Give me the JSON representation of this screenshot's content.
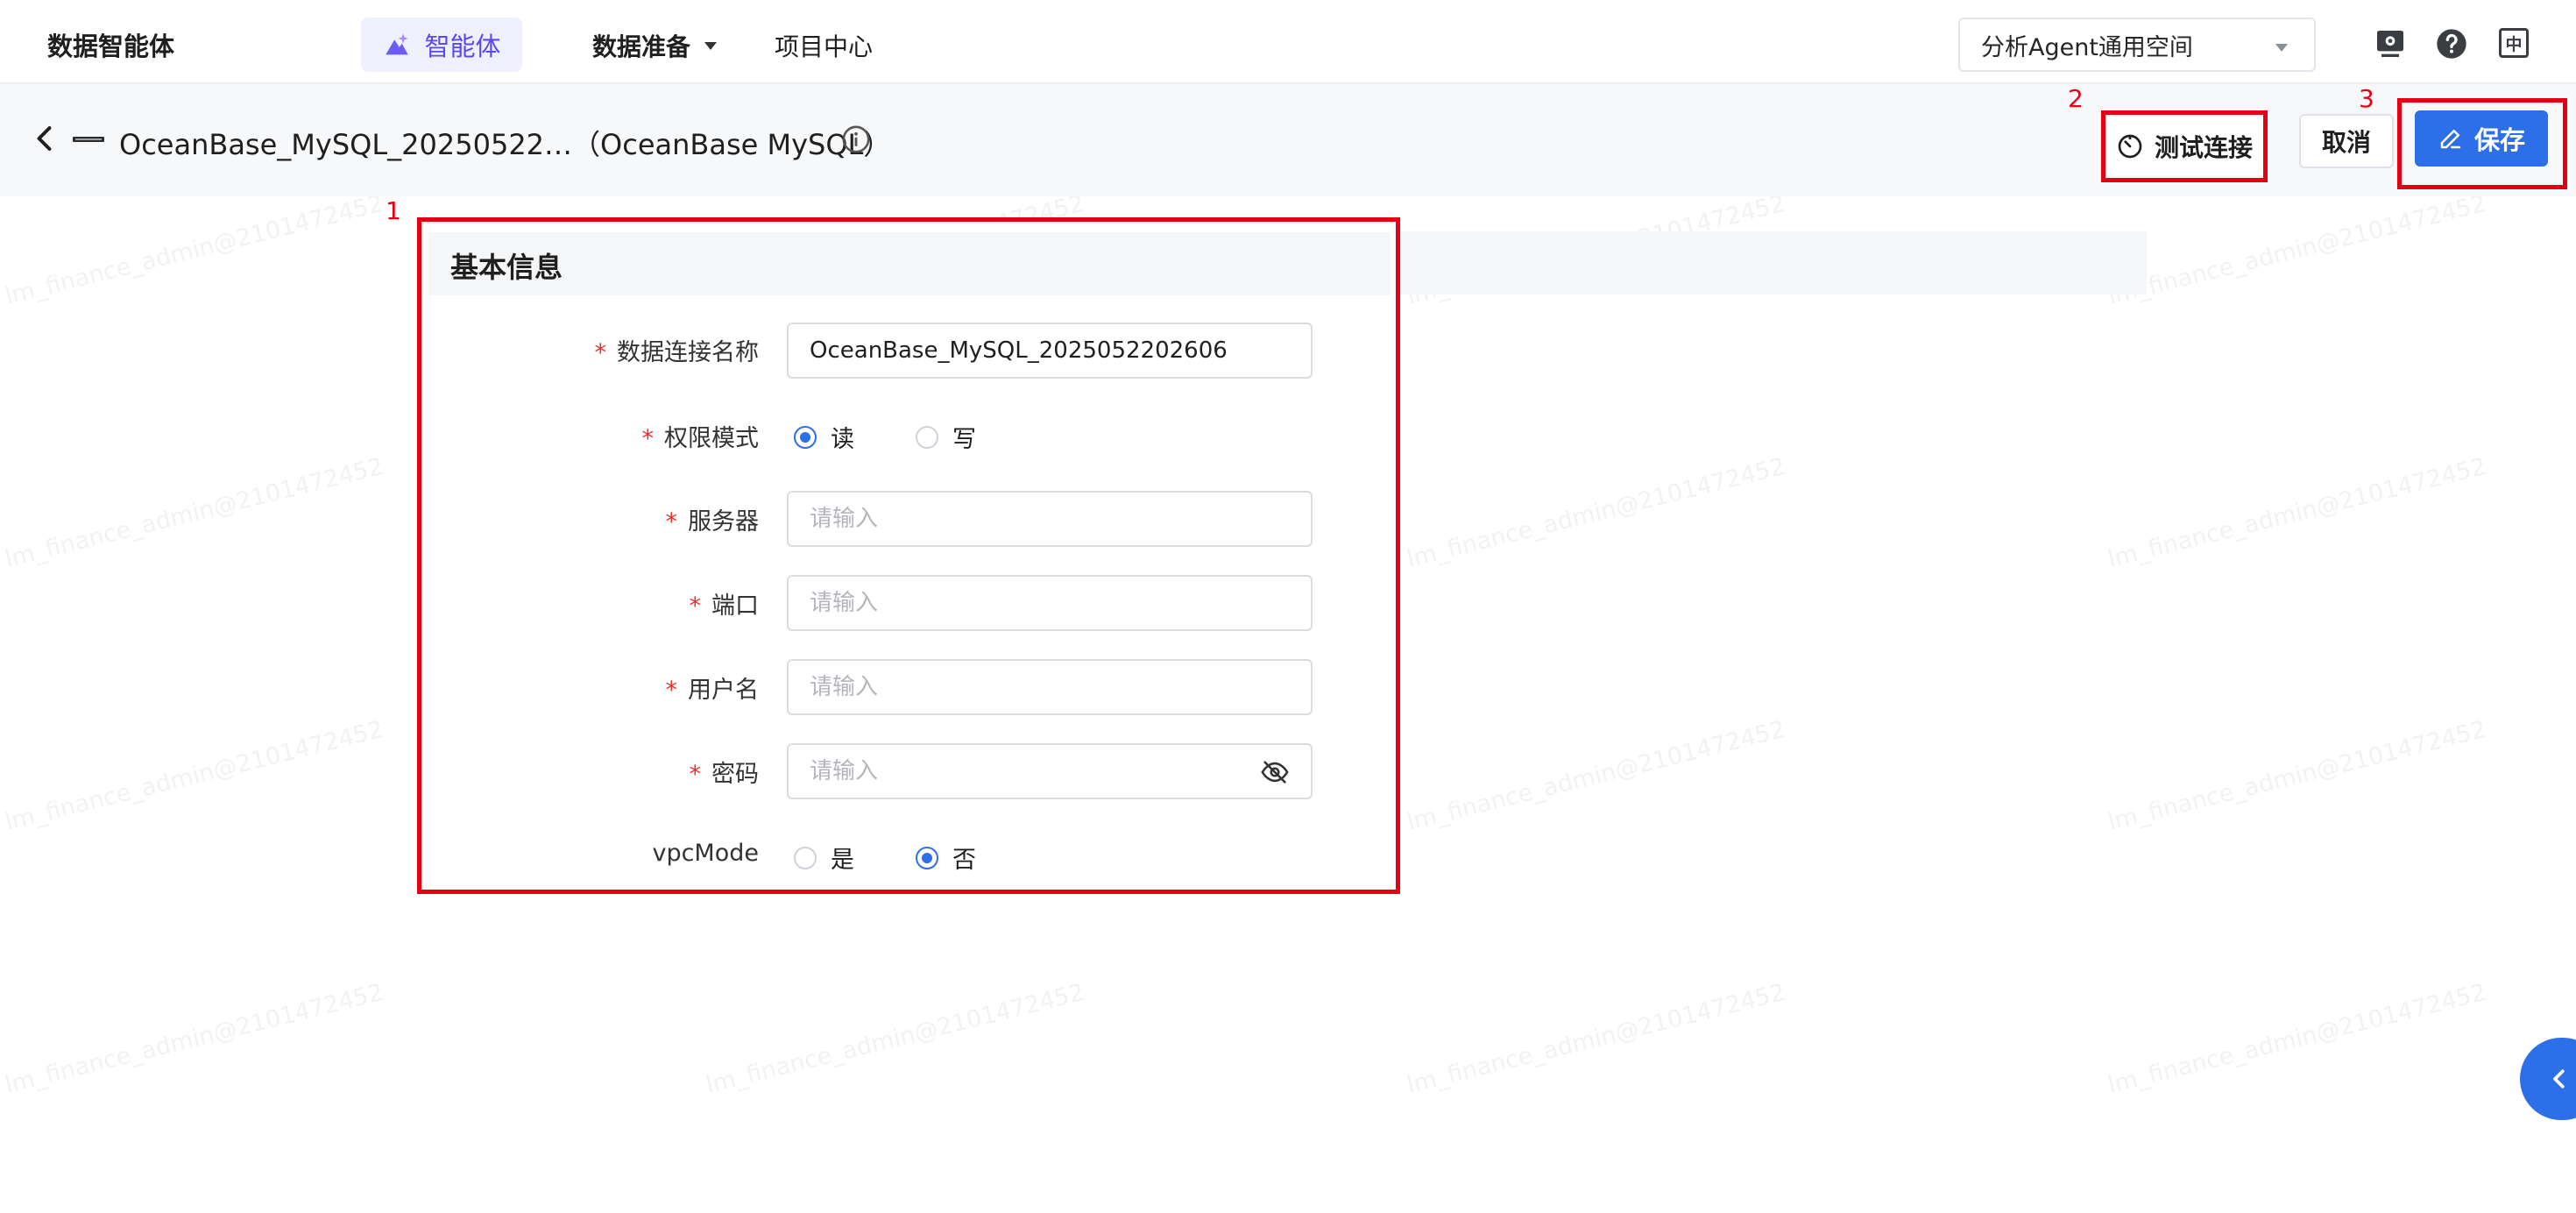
{
  "nav": {
    "brand": "数据智能体",
    "agent_tab": "智能体",
    "data_prep": "数据准备",
    "project_center": "项目中心",
    "workspace": "分析Agent通用空间",
    "lang": "中"
  },
  "header": {
    "title": "OceanBase_MySQL_20250522…（OceanBase MySQL）",
    "test_connection": "测试连接",
    "cancel": "取消",
    "save": "保存"
  },
  "annotations": {
    "m1": "1",
    "m2": "2",
    "m3": "3"
  },
  "form": {
    "section_title": "基本信息",
    "name": {
      "label": "数据连接名称",
      "value": "OceanBase_MySQL_2025052202606"
    },
    "permission": {
      "label": "权限模式",
      "options": [
        "读",
        "写"
      ],
      "selected": "读"
    },
    "server": {
      "label": "服务器",
      "placeholder": "请输入"
    },
    "port": {
      "label": "端口",
      "placeholder": "请输入"
    },
    "username": {
      "label": "用户名",
      "placeholder": "请输入"
    },
    "password": {
      "label": "密码",
      "placeholder": "请输入"
    },
    "vpc": {
      "label": "vpcMode",
      "options": [
        "是",
        "否"
      ],
      "selected": "否"
    }
  },
  "watermark": "lm_finance_admin@2101472452",
  "colors": {
    "primary": "#2d6fe8",
    "accent": "#5b49f0",
    "annotation": "#e50012",
    "required": "#e5322d"
  }
}
